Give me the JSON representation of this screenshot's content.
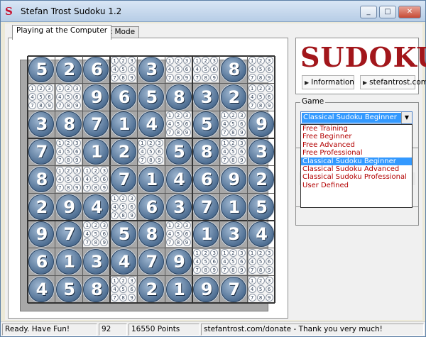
{
  "window": {
    "title": "Stefan Trost Sudoku 1.2",
    "controls": [
      "minimize",
      "maximize",
      "close"
    ]
  },
  "tabs": [
    {
      "label": "Playing at the Computer",
      "active": true
    },
    {
      "label": "Print Mode",
      "active": false
    }
  ],
  "board": {
    "rows": [
      [
        "5",
        "2",
        "6",
        "",
        "3",
        "",
        "",
        "8",
        ""
      ],
      [
        "",
        "",
        "9",
        "6",
        "5",
        "8",
        "3",
        "2",
        ""
      ],
      [
        "3",
        "8",
        "7",
        "1",
        "4",
        "",
        "5",
        "",
        "9"
      ],
      [
        "7",
        "",
        "1",
        "2",
        "",
        "5",
        "8",
        "",
        "3"
      ],
      [
        "8",
        "",
        "",
        "7",
        "1",
        "4",
        "6",
        "9",
        "2"
      ],
      [
        "2",
        "9",
        "4",
        "",
        "6",
        "3",
        "7",
        "1",
        "5"
      ],
      [
        "9",
        "7",
        "",
        "5",
        "8",
        "",
        "1",
        "3",
        "4"
      ],
      [
        "6",
        "1",
        "3",
        "4",
        "7",
        "9",
        "",
        "",
        ""
      ],
      [
        "4",
        "5",
        "8",
        "",
        "2",
        "1",
        "9",
        "7",
        ""
      ]
    ],
    "candidate_digits": [
      "1",
      "2",
      "3",
      "4",
      "5",
      "6",
      "7",
      "8",
      "9"
    ]
  },
  "logo": {
    "text": "SUDOKU"
  },
  "links": {
    "information": "Information",
    "website": "stefantrost.com"
  },
  "game": {
    "group_label": "Game",
    "selected": "Classical Sudoku Beginner",
    "options": [
      "Free Training",
      "Free Beginner",
      "Free Advanced",
      "Free Professional",
      "Classical Sudoku Beginner",
      "Classical Sudoku Advanced",
      "Classical Sudoku Professional",
      "User Defined"
    ]
  },
  "status": {
    "message": "Ready. Have Fun!",
    "count": "92",
    "points": "16550 Points",
    "donate": "stefantrost.com/donate - Thank you very much!"
  },
  "colors": {
    "logo": "#a2161b",
    "ball": "#4f6f93",
    "selection": "#3399ff",
    "option_text": "#b30000"
  }
}
